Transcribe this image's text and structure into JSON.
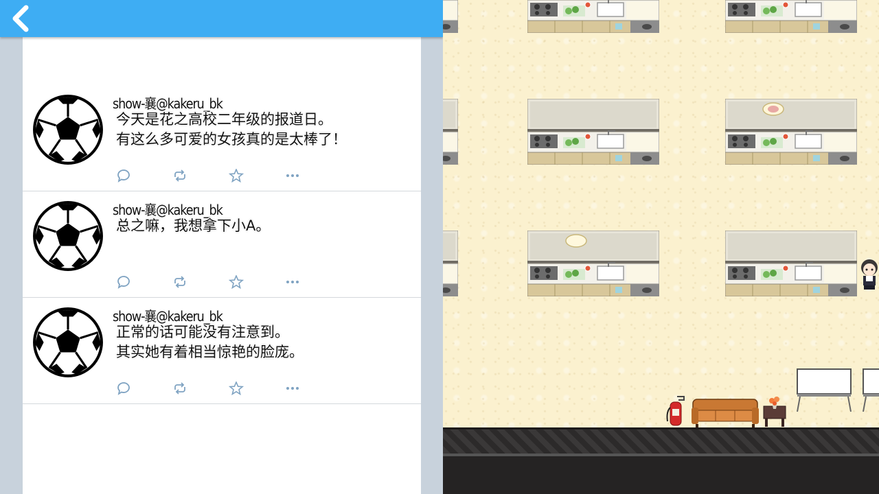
{
  "header": {
    "back_icon": "chevron-left-icon",
    "color": "#3eadf3"
  },
  "tweets": [
    {
      "avatar_icon": "soccer-ball-icon",
      "handle": "show-襄@kakeru_bk",
      "text": "今天是花之高校二年级的报道日。\n有这么多可爱的女孩真的是太棒了！"
    },
    {
      "avatar_icon": "soccer-ball-icon",
      "handle": "show-襄@kakeru_bk",
      "text": "总之嘛，我想拿下小A。"
    },
    {
      "avatar_icon": "soccer-ball-icon",
      "handle": "show-襄@kakeru_bk",
      "text": "正常的话可能没有注意到。\n其实她有着相当惊艳的脸庞。"
    }
  ],
  "tweet_actions": [
    "reply-icon",
    "retweet-icon",
    "favorite-star-icon",
    "more-dots-icon"
  ],
  "map": {
    "floor_color": "#fbf1cf",
    "objects": [
      "kitchen-counter",
      "fire-extinguisher",
      "sofa",
      "side-table-with-flowers",
      "whiteboard",
      "player-character"
    ]
  }
}
